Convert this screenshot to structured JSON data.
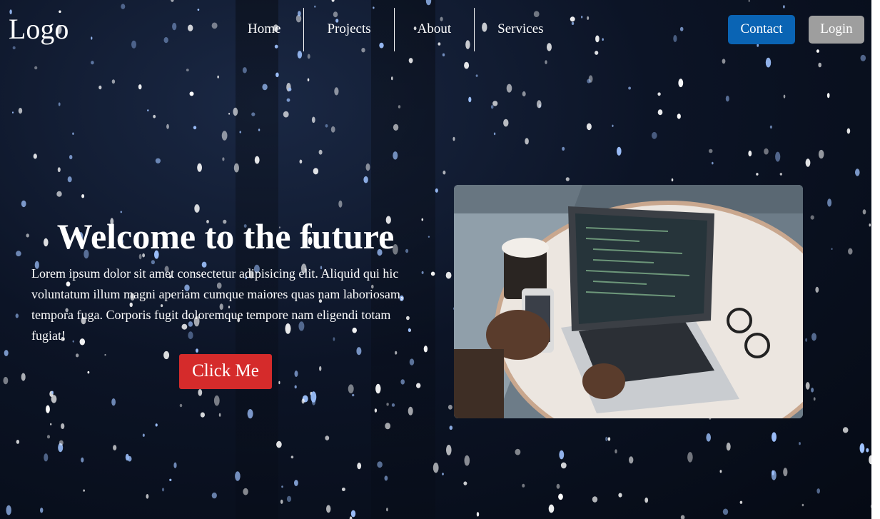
{
  "navbar": {
    "logo": "Logo",
    "links": [
      "Home",
      "Projects",
      "About",
      "Services"
    ],
    "contact_label": "Contact",
    "login_label": "Login"
  },
  "hero": {
    "title": "Welcome to the future",
    "text": "Lorem ipsum dolor sit amet consectetur adipisicing elit. Aliquid qui hic voluntatum illum magni aperiam cumque maiores quas nam laboriosam, tempora fuga. Corporis fugit doloremque tempore nam eligendi totam fugiat!",
    "button_label": "Click Me",
    "image": "laptop-workspace-photo"
  },
  "colors": {
    "contact_button": "#0a64b4",
    "login_button": "#9e9e9e",
    "click_button": "#d52b2b",
    "background": "#0c1426"
  }
}
